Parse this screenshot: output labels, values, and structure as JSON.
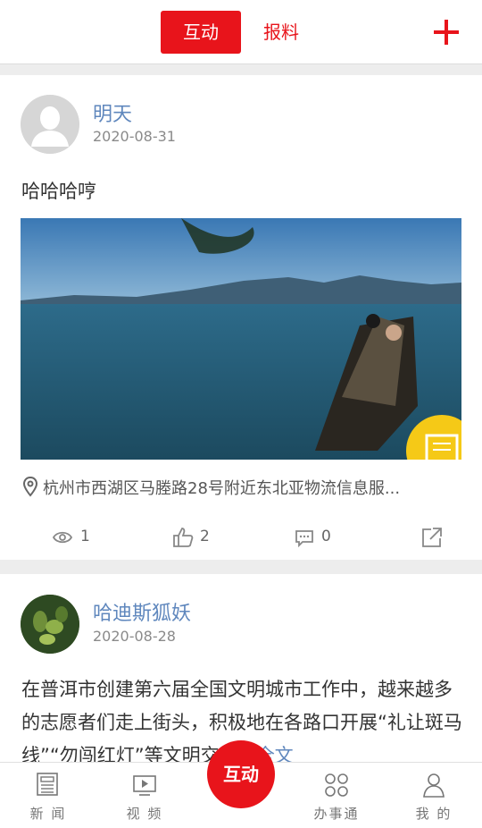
{
  "header": {
    "tabs": [
      {
        "label": "互动",
        "active": true
      },
      {
        "label": "报料",
        "active": false
      }
    ],
    "accent_color": "#e8141b"
  },
  "posts": [
    {
      "username": "明天",
      "date": "2020-08-31",
      "text": "哈哈哈哼",
      "location": "杭州市西湖区马塍路28号附近东北亚物流信息服...",
      "views": "1",
      "likes": "2",
      "comments": "0"
    },
    {
      "username": "哈迪斯狐妖",
      "date": "2020-08-28",
      "text": "在普洱市创建第六届全国文明城市工作中，越来越多的志愿者们走上街头，积极地在各路口开展“礼让斑马线”“勿闯红灯”等文明交通..",
      "more_label": "全文"
    }
  ],
  "bottom_nav": {
    "items": [
      {
        "label": "新 闻",
        "icon": "newspaper-icon"
      },
      {
        "label": "视 频",
        "icon": "video-icon"
      },
      {
        "label": "互动",
        "icon": "interaction"
      },
      {
        "label": "办事通",
        "icon": "grid-icon"
      },
      {
        "label": "我 的",
        "icon": "user-icon"
      }
    ]
  }
}
